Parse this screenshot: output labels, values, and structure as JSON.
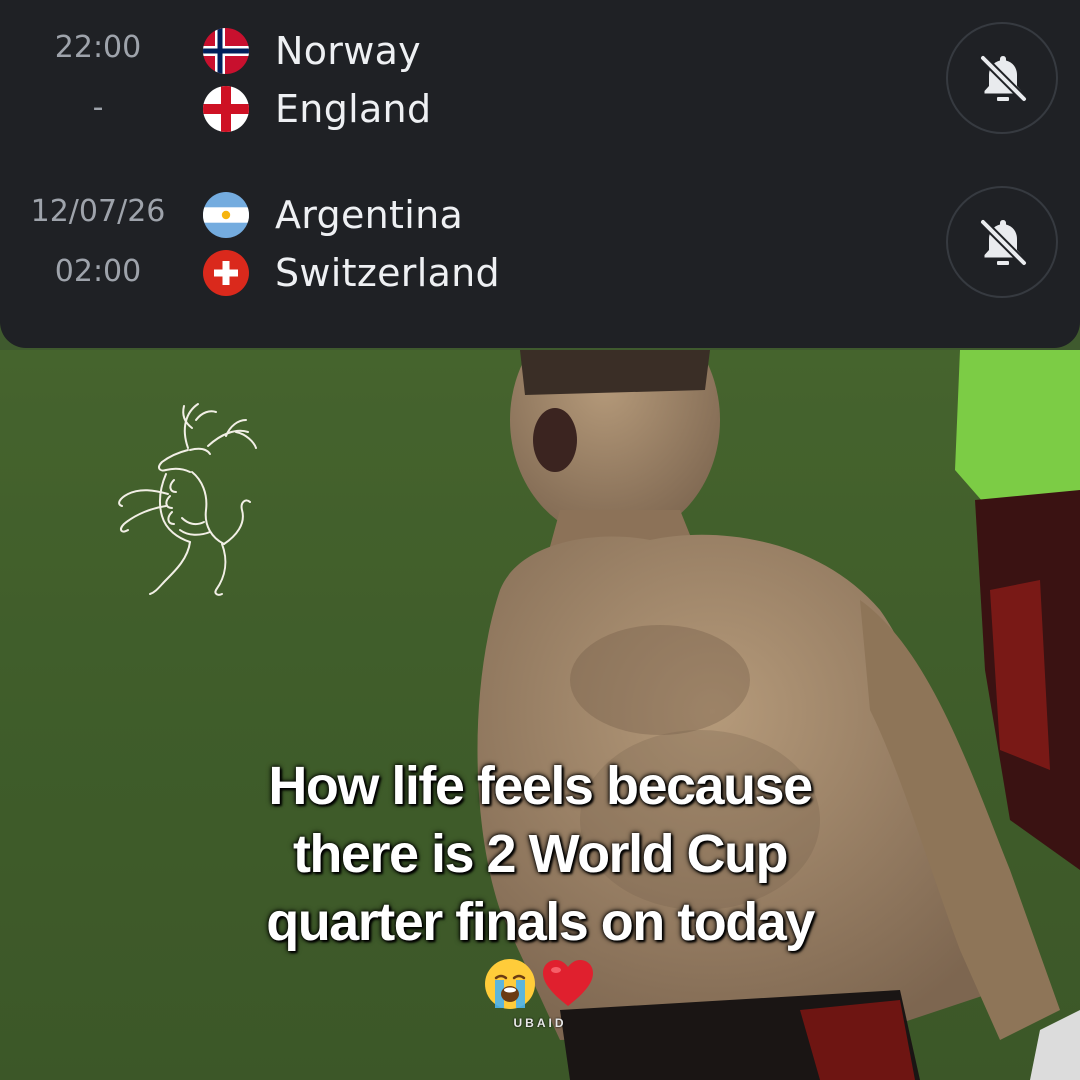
{
  "matches": [
    {
      "time_line1": "22:00",
      "time_line2": "-",
      "home": {
        "name": "Norway",
        "flag": "norway-flag"
      },
      "away": {
        "name": "England",
        "flag": "england-flag"
      },
      "notification_icon": "bell-off-icon"
    },
    {
      "time_line1": "12/07/26",
      "time_line2": "02:00",
      "home": {
        "name": "Argentina",
        "flag": "argentina-flag"
      },
      "away": {
        "name": "Switzerland",
        "flag": "switzerland-flag"
      },
      "notification_icon": "bell-off-icon"
    }
  ],
  "video": {
    "caption_lines": [
      "How life feels because",
      "there is 2 World Cup",
      "quarter finals on today"
    ],
    "emojis": [
      "loudly-crying-face",
      "red-heart"
    ],
    "watermark": "UBAID",
    "logo": "rampant-stag-logo"
  },
  "colors": {
    "panel_background": "#1f2125",
    "team_text": "#eef0f3",
    "time_text": "#9ea3ab",
    "caption_text": "#ffffff",
    "pitch_green": "#3f5a2e"
  }
}
